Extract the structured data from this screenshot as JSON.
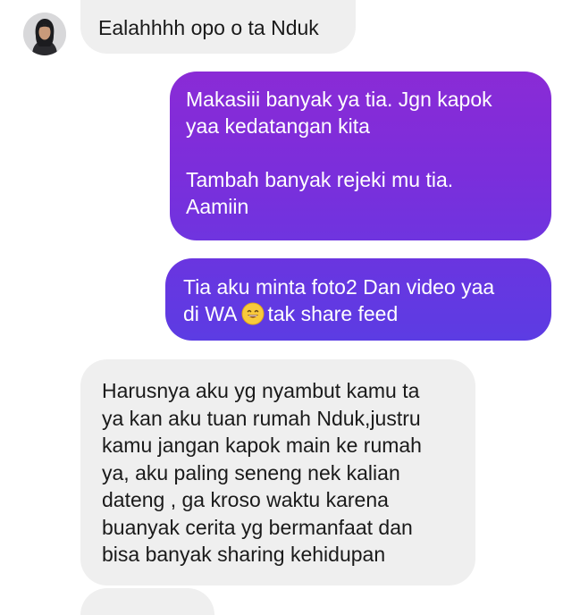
{
  "conversation": {
    "messages": [
      {
        "sender": "them",
        "text": "Ealahhhh opo o ta Nduk"
      },
      {
        "sender": "me",
        "text": "Makasiii banyak ya tia. Jgn kapok\nyaa kedatangan kita\n\nTambah banyak rejeki mu tia.\nAamiin"
      },
      {
        "sender": "me",
        "text_before": "Tia aku minta foto2 Dan video yaa\ndi WA",
        "emoji": "grinning-face-icon",
        "text_after": "tak share feed"
      },
      {
        "sender": "them",
        "text": "Harusnya aku yg nyambut kamu ta\nya kan aku tuan rumah Nduk,justru\nkamu jangan kapok main ke rumah\nya, aku paling seneng nek kalian\ndateng , ga kroso waktu karena\nbuanyak cerita yg bermanfaat dan\nbisa banyak sharing kehidupan"
      },
      {
        "sender": "them",
        "text": ""
      }
    ]
  },
  "colors": {
    "incoming_bubble": "#efefef",
    "outgoing_gradient_top": "#8a2bd6",
    "outgoing_gradient_bottom": "#5c3ce3",
    "outgoing_text": "#ffffff",
    "incoming_text": "#1a1a1a"
  }
}
